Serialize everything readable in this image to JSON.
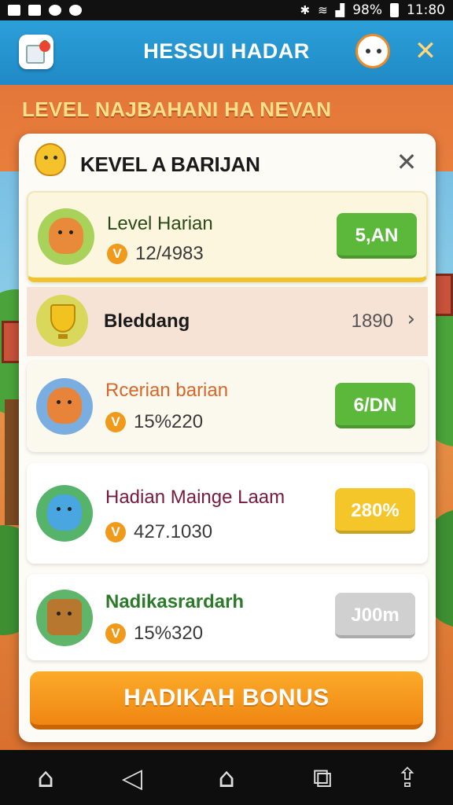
{
  "status_bar": {
    "battery": "98%",
    "time": "11:80",
    "icons": [
      "notification-a-icon",
      "image-icon",
      "heart-icon",
      "record-icon",
      "bluetooth-icon",
      "wifi-icon",
      "signal-icon",
      "battery-icon"
    ]
  },
  "header": {
    "title": "HESSUI HADAR",
    "icons": [
      "app-logo-icon",
      "mascot-icon",
      "close-icon"
    ],
    "close_glyph": "✕"
  },
  "banner": {
    "text": "LEVEL NAJBAHANI HA NEVAN"
  },
  "modal": {
    "title": "KEVEL A BARIJAN",
    "close_glyph": "✕",
    "rows": [
      {
        "name": "Level Harian",
        "points": "12/4983",
        "button": "5,AN",
        "icon": "fox-avatar-icon",
        "state": "selected"
      },
      {
        "name": "Bleddang",
        "value": "1890",
        "icon": "trophy-icon",
        "chevron": "›"
      },
      {
        "name": "Rcerian barian",
        "points": "15%220",
        "button": "6/DN",
        "icon": "fox-kid-avatar-icon"
      },
      {
        "name": "Hadian Mainge Laam",
        "points": "427.1030",
        "button": "280%",
        "icon": "blue-cat-avatar-icon"
      },
      {
        "name": "Nadikasrardarh",
        "points": "15%320",
        "button": "J00m",
        "icon": "basket-icon",
        "state": "disabled"
      }
    ],
    "check_glyph": "V",
    "bonus_button": "HADIKAH BONUS"
  },
  "colors": {
    "app_bar": "#1f8ac6",
    "reward_green": "#5cb83a",
    "reward_yellow": "#f4c62a",
    "bonus_orange": "#f08612"
  },
  "nav_bar": {
    "items": [
      "home-icon",
      "back-icon",
      "home-outline-icon",
      "recents-icon",
      "menu-icon"
    ],
    "glyphs": [
      "⌂",
      "◁",
      "⌂",
      "⧉",
      "⇪"
    ]
  }
}
